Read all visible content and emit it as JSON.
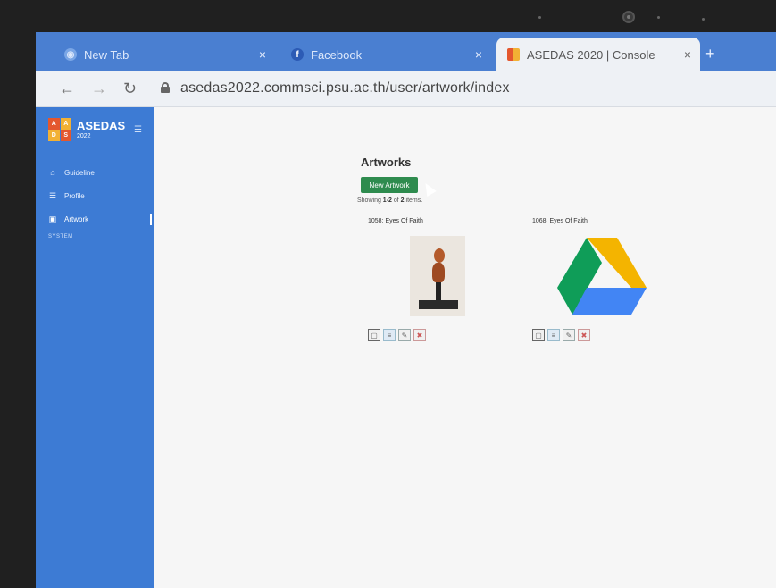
{
  "browser": {
    "tabs": [
      {
        "label": "New Tab",
        "icon": "chrome-icon",
        "close": "×"
      },
      {
        "label": "Facebook",
        "icon": "facebook-icon",
        "close": "×"
      },
      {
        "label": "ASEDAS 2020 | Console",
        "icon": "asedas-favicon",
        "close": "×"
      }
    ],
    "new_tab": "+",
    "url": "asedas2022.commsci.psu.ac.th/user/artwork/index"
  },
  "sidebar": {
    "brand_name": "ASEDAS",
    "brand_year": "2022",
    "logo_letters": [
      "A",
      "A",
      "D",
      "S"
    ],
    "items": [
      {
        "label": "Guideline",
        "icon": "home-icon"
      },
      {
        "label": "Profile",
        "icon": "profile-icon"
      },
      {
        "label": "Artwork",
        "icon": "image-icon"
      }
    ],
    "section": "SYSTEM"
  },
  "main": {
    "title": "Artworks",
    "new_button": "New Artwork",
    "summary_prefix": "Showing ",
    "summary_range": "1-2",
    "summary_mid": " of ",
    "summary_total": "2",
    "summary_suffix": " items.",
    "cards": [
      {
        "title": "1058: Eyes Of Faith",
        "image": "sculpture-image"
      },
      {
        "title": "1068: Eyes Of Faith",
        "image": "google-drive-icon"
      }
    ]
  },
  "colors": {
    "sidebar": "#3d7bd4",
    "tab_bar": "#4a7fd1",
    "new_button": "#2e8b4e"
  }
}
